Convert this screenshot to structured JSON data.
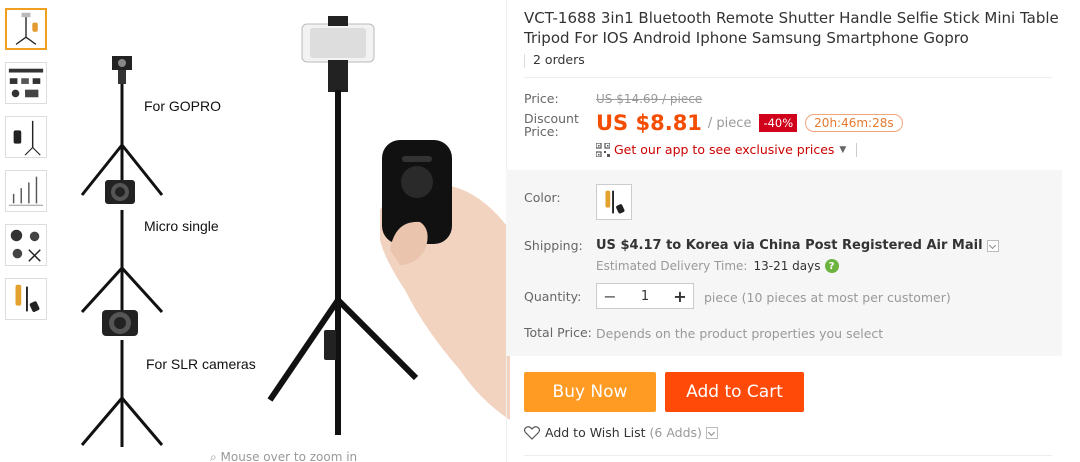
{
  "product": {
    "title": "VCT-1688 3in1 Bluetooth Remote Shutter Handle Selfie Stick Mini Table Tripod For IOS Android Iphone Samsung Smartphone Gopro",
    "orders": "2 orders"
  },
  "price": {
    "price_label": "Price:",
    "original": "US $14.69 / piece",
    "discount_label_line1": "Discount",
    "discount_label_line2": "Price:",
    "current": "US $8.81",
    "unit": "/ piece",
    "discount_badge": "-40%",
    "timer": "20h:46m:28s",
    "app_promo": "Get our app to see exclusive prices"
  },
  "options": {
    "color_label": "Color:",
    "shipping_label": "Shipping:",
    "shipping_text": "US $4.17 to Korea via China Post Registered Air Mail",
    "delivery_label": "Estimated Delivery Time:",
    "delivery_days": "13-21 days",
    "quantity_label": "Quantity:",
    "quantity_minus": "−",
    "quantity_value": "1",
    "quantity_plus": "+",
    "quantity_note": "piece (10 pieces at most per customer)",
    "total_label": "Total Price:",
    "total_note": "Depends on the product properties you select"
  },
  "actions": {
    "buy_now": "Buy Now",
    "add_to_cart": "Add to Cart",
    "wishlist": "Add to Wish List",
    "wishlist_count": "(6 Adds)"
  },
  "gallery": {
    "labels": [
      "For GOPRO",
      "Micro single",
      "For SLR cameras"
    ],
    "zoom_hint": "Mouse over to zoom in"
  },
  "colors": {
    "price_red": "#f44c00",
    "buy_orange": "#ff9a22",
    "cart_orange": "#ff4a08",
    "badge_red": "#d0021b",
    "promo_red": "#cc0000",
    "help_green": "#6cb33f"
  }
}
